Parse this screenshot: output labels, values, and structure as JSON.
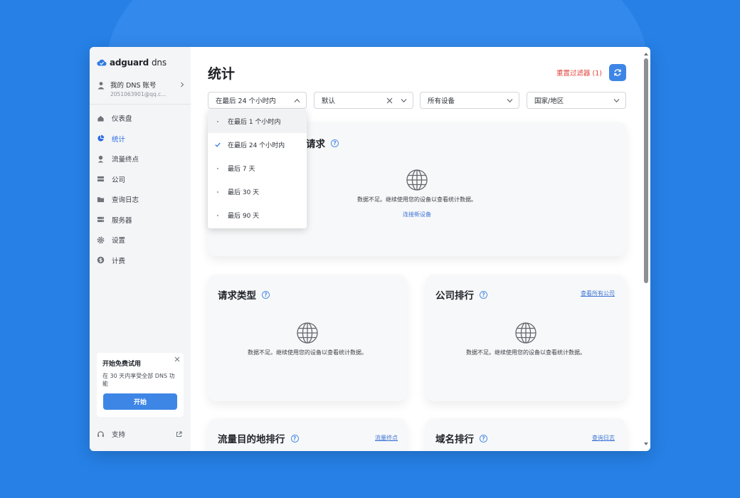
{
  "brand": {
    "name": "adguard",
    "suffix": "dns",
    "accent": "#3e86e6"
  },
  "account": {
    "title": "我的 DNS 账号",
    "email": "2051063901@qq.c..."
  },
  "nav": [
    {
      "label": "仪表盘",
      "icon": "home-icon"
    },
    {
      "label": "统计",
      "icon": "pie-chart-icon",
      "active": true
    },
    {
      "label": "流量终点",
      "icon": "user-pin-icon"
    },
    {
      "label": "公司",
      "icon": "server-icon"
    },
    {
      "label": "查询日志",
      "icon": "folder-icon"
    },
    {
      "label": "服务器",
      "icon": "servers-icon"
    },
    {
      "label": "设置",
      "icon": "gear-icon"
    },
    {
      "label": "计费",
      "icon": "dollar-icon"
    }
  ],
  "trial": {
    "title": "开始免费试用",
    "desc": "在 30 天内享受全部 DNS 功能",
    "button": "开始"
  },
  "support": {
    "label": "支持"
  },
  "header": {
    "title": "统计",
    "reset_filter": "重置过滤器 (1)"
  },
  "filters": {
    "time": "在最后 24 个小时内",
    "dns_server": "默认",
    "device": "所有设备",
    "country": "国家/地区"
  },
  "time_options": [
    {
      "label": "在最后 1 个小时内",
      "selected": false
    },
    {
      "label": "在最后 24 个小时内",
      "selected": true
    },
    {
      "label": "最后 7 天",
      "selected": false
    },
    {
      "label": "最后 30 天",
      "selected": false
    },
    {
      "label": "最后 90 天",
      "selected": false
    }
  ],
  "cards": {
    "requests": {
      "title": "请求",
      "empty_text": "数据不足。继续使用您的设备以查看统计数据。",
      "link": "连接新设备"
    },
    "request_types": {
      "title": "请求类型",
      "empty_text": "数据不足。继续使用您的设备以查看统计数据。"
    },
    "companies": {
      "title": "公司排行",
      "link": "查看所有公司",
      "empty_text": "数据不足。继续使用您的设备以查看统计数据。"
    },
    "destinations": {
      "title": "流量目的地排行",
      "link": "流量终点"
    },
    "domains": {
      "title": "域名排行",
      "link": "查询日志"
    }
  }
}
